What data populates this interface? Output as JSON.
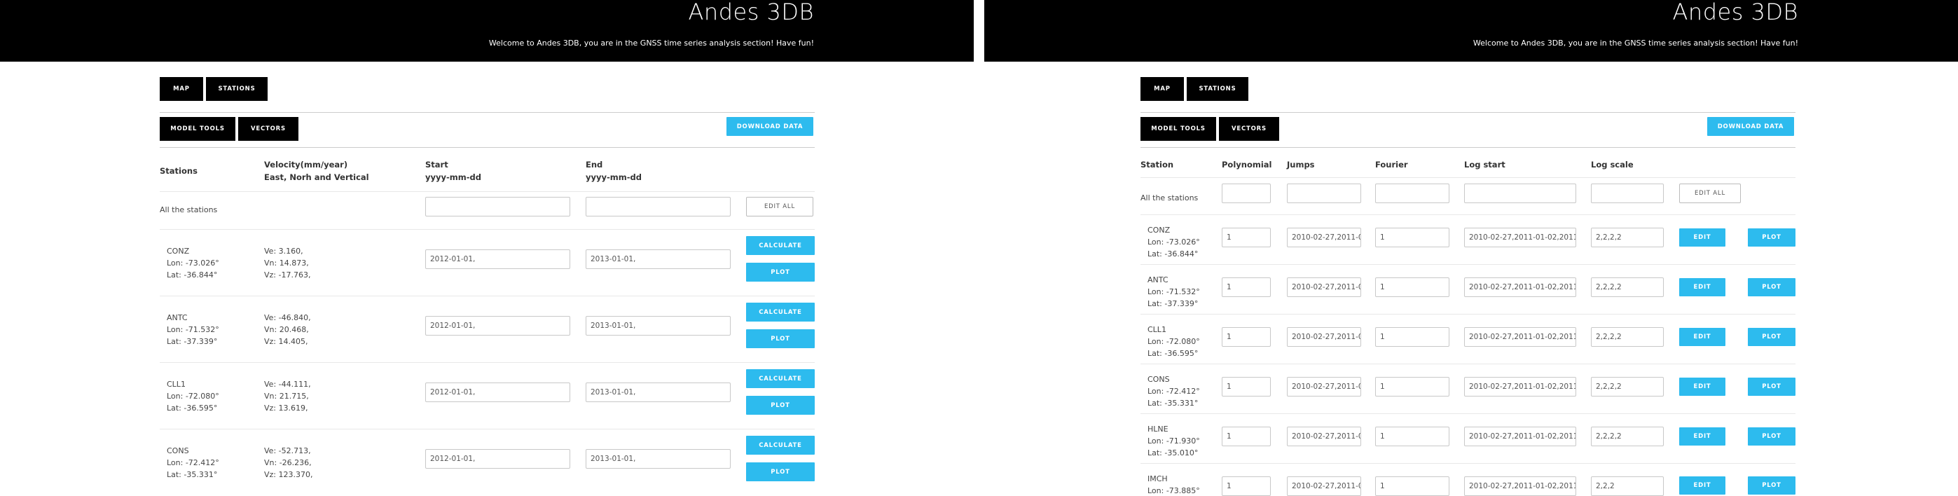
{
  "header": {
    "title": "Andes 3DB",
    "welcome": "Welcome to Andes 3DB, you are in the GNSS time series analysis section! Have fun!"
  },
  "nav": {
    "map": "MAP",
    "stations": "STATIONS"
  },
  "tools": {
    "model_tools": "MODEL TOOLS",
    "vectors": "VECTORS",
    "download": "DOWNLOAD DATA"
  },
  "left": {
    "columns": {
      "stations": "Stations",
      "velocity": "Velocity(mm/year)",
      "velocity_sub": "East, Norh and Vertical",
      "start": "Start",
      "start_fmt": "yyyy-mm-dd",
      "end": "End",
      "end_fmt": "yyyy-mm-dd"
    },
    "all_label": "All the stations",
    "edit_all": "EDIT ALL",
    "calculate": "CALCULATE",
    "plot": "PLOT",
    "rows": [
      {
        "name": "CONZ",
        "lon": "Lon: -73.026°",
        "lat": "Lat: -36.844°",
        "ve": "Ve: 3.160,",
        "vn": "Vn: 14.873,",
        "vz": "Vz: -17.763,",
        "start": "2012-01-01,",
        "end": "2013-01-01,"
      },
      {
        "name": "ANTC",
        "lon": "Lon: -71.532°",
        "lat": "Lat: -37.339°",
        "ve": "Ve: -46.840,",
        "vn": "Vn: 20.468,",
        "vz": "Vz: 14.405,",
        "start": "2012-01-01,",
        "end": "2013-01-01,"
      },
      {
        "name": "CLL1",
        "lon": "Lon: -72.080°",
        "lat": "Lat: -36.595°",
        "ve": "Ve: -44.111,",
        "vn": "Vn: 21.715,",
        "vz": "Vz: 13.619,",
        "start": "2012-01-01,",
        "end": "2013-01-01,"
      },
      {
        "name": "CONS",
        "lon": "Lon: -72.412°",
        "lat": "Lat: -35.331°",
        "ve": "Ve: -52.713,",
        "vn": "Vn: -26.236,",
        "vz": "Vz: 123.370,",
        "start": "2012-01-01,",
        "end": "2013-01-01,"
      }
    ]
  },
  "right": {
    "columns": {
      "station": "Station",
      "polynomial": "Polynomial",
      "jumps": "Jumps",
      "fourier": "Fourier",
      "log_start": "Log start",
      "log_scale": "Log scale"
    },
    "all_label": "All the stations",
    "edit_all": "EDIT ALL",
    "edit": "EDIT",
    "plot": "PLOT",
    "rows": [
      {
        "name": "CONZ",
        "lon": "Lon: -73.026°",
        "lat": "Lat: -36.844°",
        "poly": "1",
        "jumps": "2010-02-27,2011-0",
        "fourier": "1",
        "log_start": "2010-02-27,2011-01-02,2011-0",
        "log_scale": "2,2,2,2"
      },
      {
        "name": "ANTC",
        "lon": "Lon: -71.532°",
        "lat": "Lat: -37.339°",
        "poly": "1",
        "jumps": "2010-02-27,2011-0",
        "fourier": "1",
        "log_start": "2010-02-27,2011-01-02,2011-0",
        "log_scale": "2,2,2,2"
      },
      {
        "name": "CLL1",
        "lon": "Lon: -72.080°",
        "lat": "Lat: -36.595°",
        "poly": "1",
        "jumps": "2010-02-27,2011-0",
        "fourier": "1",
        "log_start": "2010-02-27,2011-01-02,2011-0",
        "log_scale": "2,2,2,2"
      },
      {
        "name": "CONS",
        "lon": "Lon: -72.412°",
        "lat": "Lat: -35.331°",
        "poly": "1",
        "jumps": "2010-02-27,2011-0",
        "fourier": "1",
        "log_start": "2010-02-27,2011-01-02,2011-0",
        "log_scale": "2,2,2,2"
      },
      {
        "name": "HLNE",
        "lon": "Lon: -71.930°",
        "lat": "Lat: -35.010°",
        "poly": "1",
        "jumps": "2010-02-27,2011-0",
        "fourier": "1",
        "log_start": "2010-02-27,2011-01-02,2011-0",
        "log_scale": "2,2,2,2"
      },
      {
        "name": "IMCH",
        "lon": "Lon: -73.885°",
        "lat": "",
        "poly": "1",
        "jumps": "2010-02-27,2011-0",
        "fourier": "1",
        "log_start": "2010-02-27,2011-01-02,2011-0",
        "log_scale": "2,2,2"
      }
    ]
  }
}
